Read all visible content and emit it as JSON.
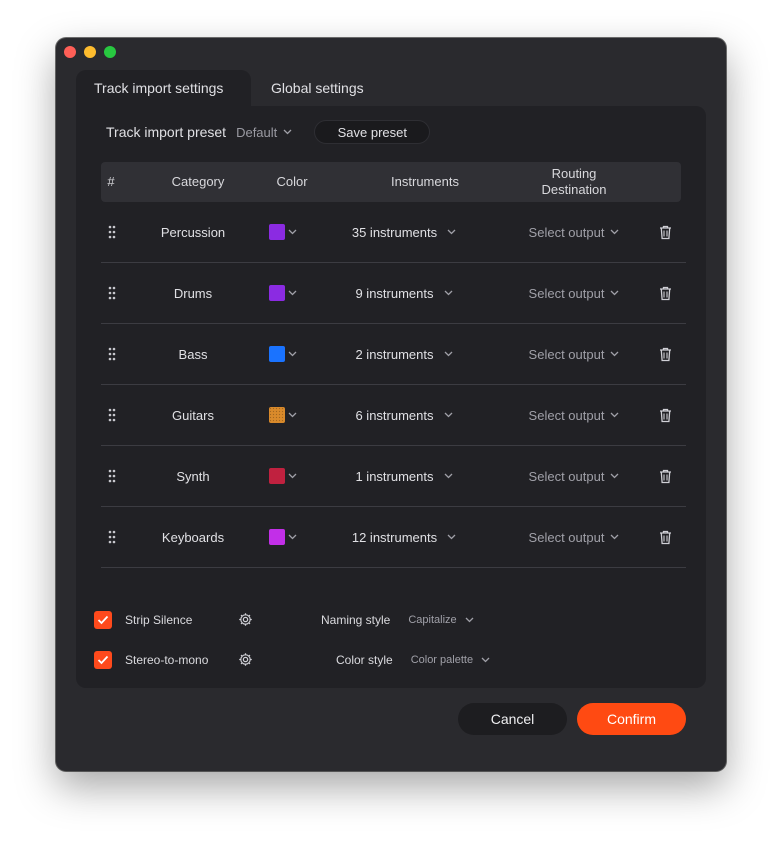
{
  "window": {
    "tabs": [
      {
        "label": "Track import settings",
        "active": true
      },
      {
        "label": "Global settings",
        "active": false
      }
    ]
  },
  "preset": {
    "label": "Track import preset",
    "value": "Default",
    "save_label": "Save preset"
  },
  "table": {
    "headers": {
      "index": "#",
      "category": "Category",
      "color": "Color",
      "instruments": "Instruments",
      "routing_line1": "Routing",
      "routing_line2": "Destination"
    },
    "rows": [
      {
        "category": "Percussion",
        "color": "#8b2be2",
        "instruments": "35 instruments",
        "routing": "Select output"
      },
      {
        "category": "Drums",
        "color": "#8b2be2",
        "instruments": "9 instruments",
        "routing": "Select output"
      },
      {
        "category": "Bass",
        "color": "#1a73ff",
        "instruments": "2 instruments",
        "routing": "Select output"
      },
      {
        "category": "Guitars",
        "color": "#d98a2b",
        "instruments": "6 instruments",
        "routing": "Select output"
      },
      {
        "category": "Synth",
        "color": "#c0213f",
        "instruments": "1 instruments",
        "routing": "Select output"
      },
      {
        "category": "Keyboards",
        "color": "#c22fe8",
        "instruments": "12 instruments",
        "routing": "Select output"
      }
    ]
  },
  "options": {
    "strip_silence": {
      "label": "Strip Silence",
      "checked": true
    },
    "stereo_to_mono": {
      "label": "Stereo-to-mono",
      "checked": true
    },
    "naming_style": {
      "label": "Naming style",
      "value": "Capitalize"
    },
    "color_style": {
      "label": "Color style",
      "value": "Color palette"
    }
  },
  "footer": {
    "cancel_label": "Cancel",
    "confirm_label": "Confirm"
  },
  "colors": {
    "accent": "#ff4a12",
    "window_bg": "#2a2a2e",
    "panel_bg": "#212125"
  }
}
